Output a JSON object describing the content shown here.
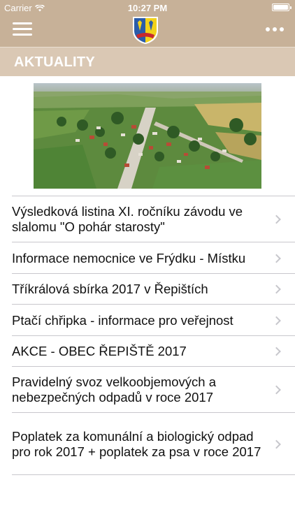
{
  "status_bar": {
    "carrier": "Carrier",
    "time": "10:27 PM",
    "wifi_icon": "wifi-icon",
    "battery_icon": "battery-icon"
  },
  "nav": {
    "menu_icon": "hamburger-menu-icon",
    "logo_icon": "coat-of-arms-logo",
    "more_icon": "more-dots-icon",
    "brand_color": "#c7b198"
  },
  "section": {
    "title": "AKTUALITY",
    "color": "#dac8b4"
  },
  "hero": {
    "image": "aerial-village-photo"
  },
  "news": [
    {
      "title": "Výsledková listina XI. ročníku závodu ve slalomu \"O pohár starosty\""
    },
    {
      "title": "Informace nemocnice ve Frýdku - Místku"
    },
    {
      "title": "Tříkrálová sbírka 2017 v Řepištích"
    },
    {
      "title": "Ptačí chřipka - informace pro veřejnost"
    },
    {
      "title": "AKCE - OBEC ŘEPIŠTĚ 2017"
    },
    {
      "title": "Pravidelný svoz velkoobjemových a nebezpečných odpadů v roce 2017"
    },
    {
      "title": "Poplatek za komunální a biologický odpad pro rok 2017 + poplatek za psa v roce 2017"
    }
  ]
}
